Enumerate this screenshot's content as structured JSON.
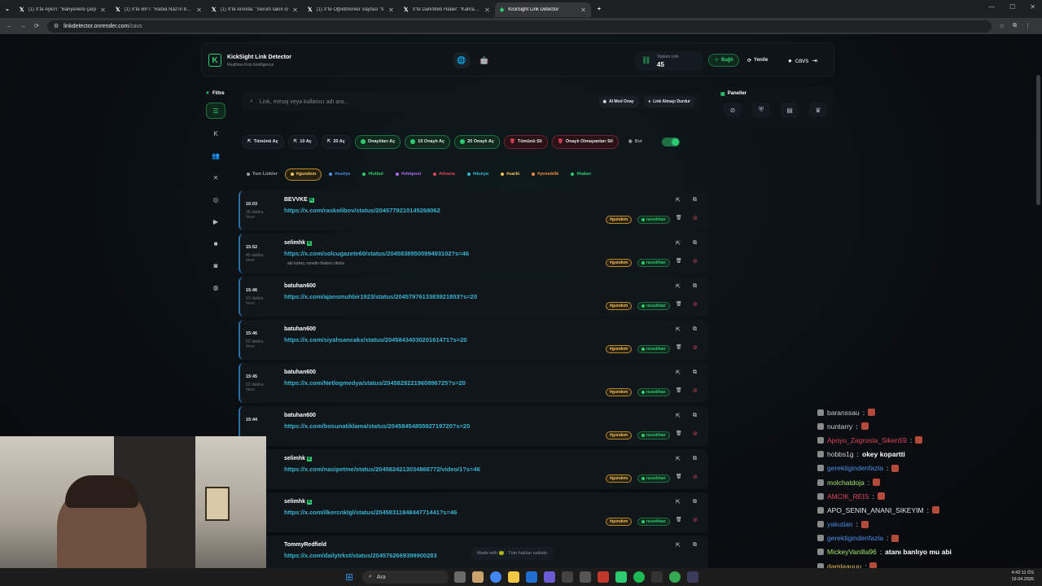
{
  "browser": {
    "tabs": [
      {
        "title": "(1) X'te Aykırı: \"Bariyerlere çarp",
        "active": false
      },
      {
        "title": "(1) X'te BPT: \"Rabia Naz'ın baba",
        "active": false
      },
      {
        "title": "(1) X'te Anında: \"Serum takılı ol",
        "active": false
      },
      {
        "title": "(1) X'te Öğretmenler Sayfası \"İl",
        "active": false
      },
      {
        "title": "X'te DarkWeb Haber: \"Kahrama",
        "active": false
      },
      {
        "title": "KickSight Link Detector",
        "active": true
      }
    ],
    "url_host": "linkdetector.onrender.com",
    "url_path": "/cavs"
  },
  "app": {
    "brand": "KickSight Link Detector",
    "brand_sub": "Realtime Kick Intelligence",
    "total_label": "Toplam Link",
    "total_value": "45",
    "connected_label": "Bağlı",
    "refresh_label": "Yenile",
    "username": "cavs",
    "filter_label": "Filtre",
    "search_placeholder": "Link, mesaj veya kullanıcı adı ara...",
    "ai_mode_label": "AI Mod Onay",
    "stop_label": "Link Almayı Durdur",
    "actions": [
      {
        "label": "Tümünü Aç",
        "style": "plain-box"
      },
      {
        "label": "10 Aç",
        "style": "plain-box"
      },
      {
        "label": "20 Aç",
        "style": "plain-box"
      },
      {
        "label": "Onaylıları Aç",
        "style": "green"
      },
      {
        "label": "10 Onaylı Aç",
        "style": "green"
      },
      {
        "label": "20 Onaylı Aç",
        "style": "green"
      },
      {
        "label": "Tümünü Sil",
        "style": "red"
      },
      {
        "label": "Onaylı Olmayanları Sil",
        "style": "red"
      }
    ],
    "bot_label": "Bot",
    "categories": [
      {
        "label": "Tum Linkler",
        "color": "#9aa0a6",
        "selected": false
      },
      {
        "label": "#gundem",
        "color": "#f1c15a",
        "selected": true
      },
      {
        "label": "#suriye",
        "color": "#4d8fe8",
        "selected": false
      },
      {
        "label": "#futbol",
        "color": "#2ecc71",
        "selected": false
      },
      {
        "label": "#shitpost",
        "color": "#b26bf0",
        "selected": false
      },
      {
        "label": "#drama",
        "color": "#e0455b",
        "selected": false
      },
      {
        "label": "#dunya",
        "color": "#37b4d3",
        "selected": false
      },
      {
        "label": "#sarki",
        "color": "#f1c15a",
        "selected": false
      },
      {
        "label": "#yemeklik",
        "color": "#f08a3c",
        "selected": false
      },
      {
        "label": "#haber",
        "color": "#2ecc71",
        "selected": false
      }
    ],
    "panels_label": "Paneller",
    "footer": "Made with 🐸 · Tüm hakları saklıdır"
  },
  "links": [
    {
      "time": "16:03",
      "ago": "35 dakika önce",
      "user": "BEVVKE",
      "kick": true,
      "url": "https://x.com/raskolibov/status/2045779210145268062",
      "msg": "",
      "tag": "#gundem",
      "approver": "nusokhan"
    },
    {
      "time": "15:52",
      "ago": "46 dakika önce",
      "user": "selimhk",
      "kick": true,
      "url": "https://x.com/solcugazete60/status/2045838950099493102?s=46",
      "msg": "abi turkey sonelin ifadesi cikmis",
      "tag": "#gundem",
      "approver": "nusokhan"
    },
    {
      "time": "15:46",
      "ago": "52 dakika önce",
      "user": "batuhan600",
      "kick": false,
      "url": "https://x.com/ajansmuhbir1923/status/2045797613383921803?s=20",
      "msg": "",
      "tag": "#gundem",
      "approver": "nusokhan"
    },
    {
      "time": "15:46",
      "ago": "52 dakika önce",
      "user": "batuhan600",
      "kick": false,
      "url": "https://x.com/siyahsancakx/status/2045843403020161471?s=20",
      "msg": "",
      "tag": "#gundem",
      "approver": "nusokhan"
    },
    {
      "time": "15:45",
      "ago": "53 dakika önce",
      "user": "batuhan600",
      "kick": false,
      "url": "https://x.com/Netlogmedya/status/2045829221960896725?s=20",
      "msg": "",
      "tag": "#gundem",
      "approver": "nusokhan"
    },
    {
      "time": "15:44",
      "ago": "",
      "user": "batuhan600",
      "kick": false,
      "url": "https://x.com/bosunatiklama/status/2045845485592719720?s=20",
      "msg": "",
      "tag": "#gundem",
      "approver": "nusokhan"
    },
    {
      "time": "",
      "ago": "",
      "user": "selimhk",
      "kick": true,
      "url": "https://x.com/nasipetme/status/2045824213034868772/video/1?s=46",
      "msg": "",
      "tag": "#gundem",
      "approver": "nusokhan"
    },
    {
      "time": "",
      "ago": "",
      "user": "selimhk",
      "kick": true,
      "url": "https://x.com/ilkercnklgl/status/2045831184844771441?s=46",
      "msg": "",
      "tag": "#gundem",
      "approver": "nusokhan"
    },
    {
      "time": "",
      "ago": "",
      "user": "TommyRedfield",
      "kick": false,
      "url": "https://x.com/dailytrkst/status/2045762669399900283",
      "msg": "",
      "tag": "",
      "approver": ""
    }
  ],
  "chat": [
    {
      "user": "baranssau",
      "color": "#c8c8c8",
      "text": ""
    },
    {
      "user": "nuntarry",
      "color": "#d0d0d0",
      "text": ""
    },
    {
      "user": "Apoyu_Zagrosta_Siken59",
      "color": "#e0455b",
      "text": ""
    },
    {
      "user": "hobbs1g",
      "color": "#d0d0d0",
      "text": "okey kopartti"
    },
    {
      "user": "gerektigindenfazla",
      "color": "#4d8fe8",
      "text": ""
    },
    {
      "user": "molchatdoja",
      "color": "#a6e36b",
      "text": ""
    },
    {
      "user": "AMCIK_REIS",
      "color": "#e0455b",
      "text": ""
    },
    {
      "user": "APO_SENIN_ANANI_SIKEYIM",
      "color": "#e6e6e6",
      "text": ""
    },
    {
      "user": "yakutian",
      "color": "#4d8fe8",
      "text": ""
    },
    {
      "user": "gerektigindenfazla",
      "color": "#4d8fe8",
      "text": ""
    },
    {
      "user": "MickeyVanilla96",
      "color": "#a6e36b",
      "text": "atanı banlıyo mu abi"
    },
    {
      "user": "damlaauuu",
      "color": "#f1c15a",
      "text": ""
    }
  ],
  "taskbar": {
    "search": "Ara",
    "time": "4:42:11 ÖS",
    "date": "19.04.2026"
  }
}
